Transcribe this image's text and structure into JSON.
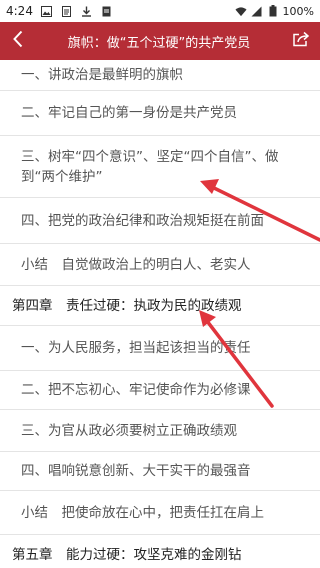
{
  "status_bar": {
    "time": "4:24",
    "battery": "100%",
    "icons_left": [
      "image-icon",
      "document-icon",
      "download-icon",
      "document-icon"
    ],
    "icons_right": [
      "wifi-icon",
      "signal-icon",
      "battery-icon"
    ]
  },
  "header": {
    "title": "旗帜：做“五个过硬”的共产党员",
    "background": "#b52d36"
  },
  "toc": [
    {
      "type": "sub",
      "text": "一、讲政治是最鲜明的旗帜"
    },
    {
      "type": "sub",
      "text": "二、牢记自己的第一身份是共产党员"
    },
    {
      "type": "sub",
      "text": "三、树牢“四个意识”、坚定“四个自信”、做到“两个维护”"
    },
    {
      "type": "sub",
      "text": "四、把党的政治纪律和政治规矩挺在前面"
    },
    {
      "type": "sub",
      "text": "小结　自觉做政治上的明白人、老实人"
    },
    {
      "type": "chapter",
      "text": "第四章　责任过硬：执政为民的政绩观"
    },
    {
      "type": "sub",
      "text": "一、为人民服务，担当起该担当的责任"
    },
    {
      "type": "sub",
      "text": "二、把不忘初心、牢记使命作为必修课"
    },
    {
      "type": "sub",
      "text": "三、为官从政必须要树立正确政绩观"
    },
    {
      "type": "sub",
      "text": "四、唱响锐意创新、大干实干的最强音"
    },
    {
      "type": "sub",
      "text": "小结　把使命放在心中，把责任扛在肩上"
    },
    {
      "type": "chapter",
      "text": "第五章　能力过硬：攻坚克难的金刚钻"
    }
  ],
  "annotation_color": "#e0353d"
}
